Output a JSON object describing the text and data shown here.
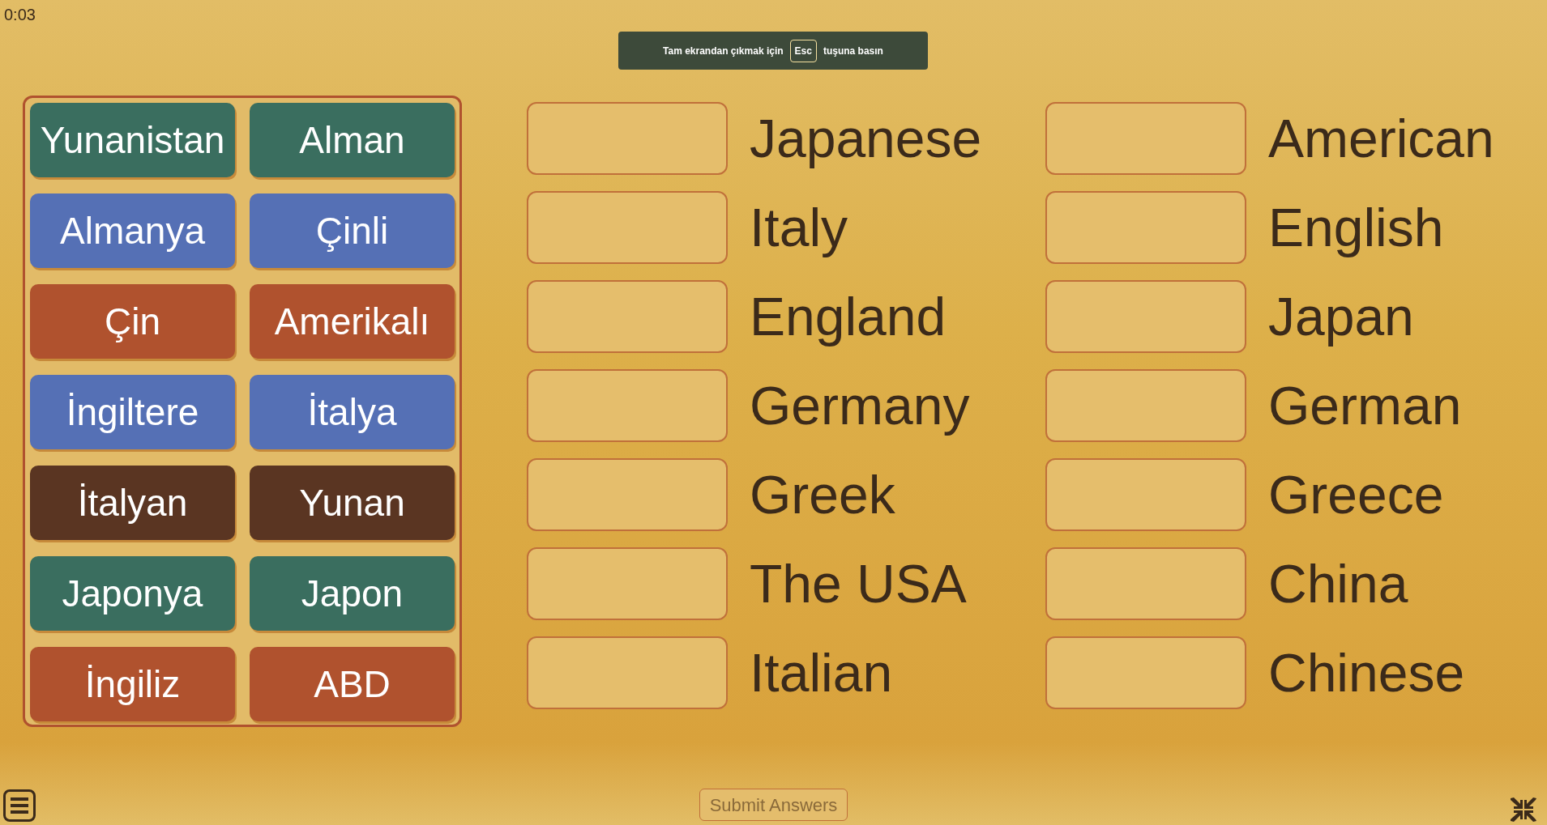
{
  "timer": "0:03",
  "fullscreen_notice": {
    "before": "Tam ekrandan çıkmak için",
    "key": "Esc",
    "after": "tuşuna basın"
  },
  "tiles": [
    {
      "label": "Yunanistan",
      "color": "#3a6e5f"
    },
    {
      "label": "Alman",
      "color": "#3a6e5f"
    },
    {
      "label": "Almanya",
      "color": "#5570b5"
    },
    {
      "label": "Çinli",
      "color": "#5570b5"
    },
    {
      "label": "Çin",
      "color": "#b0522e"
    },
    {
      "label": "Amerikalı",
      "color": "#b0522e"
    },
    {
      "label": "İngiltere",
      "color": "#5570b5"
    },
    {
      "label": "İtalya",
      "color": "#5570b5"
    },
    {
      "label": "İtalyan",
      "color": "#5a3522"
    },
    {
      "label": "Yunan",
      "color": "#5a3522"
    },
    {
      "label": "Japonya",
      "color": "#3a6e5f"
    },
    {
      "label": "Japon",
      "color": "#3a6e5f"
    },
    {
      "label": "İngiliz",
      "color": "#b0522e"
    },
    {
      "label": "ABD",
      "color": "#b0522e"
    }
  ],
  "targets": [
    {
      "label": "Japanese"
    },
    {
      "label": "American"
    },
    {
      "label": "Italy"
    },
    {
      "label": "English"
    },
    {
      "label": "England"
    },
    {
      "label": "Japan"
    },
    {
      "label": "Germany"
    },
    {
      "label": "German"
    },
    {
      "label": "Greek"
    },
    {
      "label": "Greece"
    },
    {
      "label": "The USA"
    },
    {
      "label": "China"
    },
    {
      "label": "Italian"
    },
    {
      "label": "Chinese"
    }
  ],
  "submit_button": {
    "label": "Submit Answers",
    "disabled": true
  }
}
